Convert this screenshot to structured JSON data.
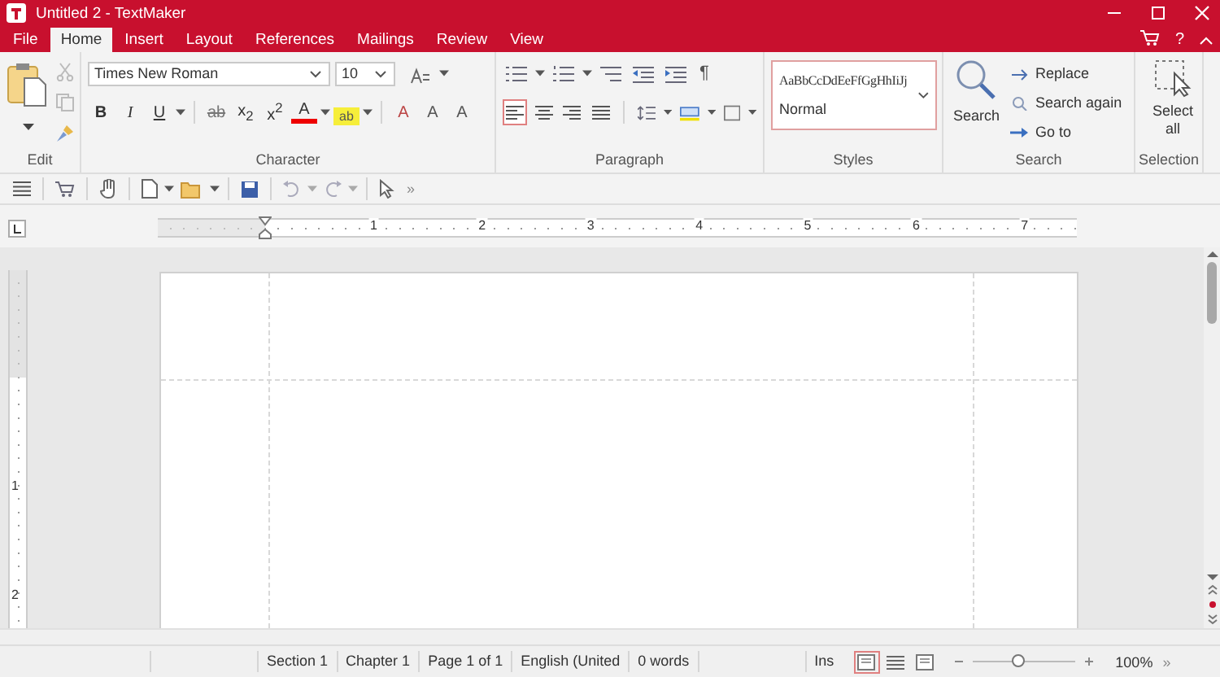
{
  "window": {
    "title": "Untitled 2 - TextMaker"
  },
  "tabs": [
    {
      "label": "File",
      "selected": false
    },
    {
      "label": "Home",
      "selected": true
    },
    {
      "label": "Insert",
      "selected": false
    },
    {
      "label": "Layout",
      "selected": false
    },
    {
      "label": "References",
      "selected": false
    },
    {
      "label": "Mailings",
      "selected": false
    },
    {
      "label": "Review",
      "selected": false
    },
    {
      "label": "View",
      "selected": false
    }
  ],
  "help": "?",
  "ribbon": {
    "font_name": "Times New Roman",
    "font_size": "10",
    "character_buttons": [
      {
        "kind": "bold",
        "glyph": "B"
      },
      {
        "kind": "italic",
        "glyph": "I"
      },
      {
        "kind": "underline",
        "glyph": "U"
      },
      {
        "kind": "strike",
        "glyph": "ab"
      },
      {
        "kind": "subscript",
        "glyph": "x$_{2}$"
      },
      {
        "kind": "superscript",
        "glyph": "x$^{2}$"
      },
      {
        "kind": "color",
        "glyph": "A"
      },
      {
        "kind": "highlight",
        "glyph": "ab"
      },
      {
        "kind": "clear",
        "glyph": "A"
      },
      {
        "kind": "grow",
        "glyph": "A"
      },
      {
        "kind": "shrink",
        "glyph": "A"
      }
    ],
    "paragraph_mark": "¶",
    "alignments": [
      {
        "selected": true
      },
      {
        "selected": false
      },
      {
        "selected": false
      },
      {
        "selected": false
      }
    ],
    "styles": {
      "sample": "AaBbCcDdEeFfGgHhIiJj",
      "current": "Normal"
    },
    "search": {
      "label": "Search",
      "actions": [
        "Replace",
        "Search again",
        "Go to"
      ]
    },
    "select_all": "Select all",
    "groups": [
      "Edit",
      "Character",
      "Paragraph",
      "Styles",
      "Search",
      "Selection"
    ]
  },
  "toolbar": {
    "more": "»"
  },
  "ruler": {
    "marks": [
      "1",
      "2",
      "3",
      "4",
      "5",
      "6",
      "7"
    ]
  },
  "vertical_ruler": {
    "marks": [
      "1",
      "2"
    ]
  },
  "status_bar": {
    "cells": [
      "Section 1",
      "Chapter 1",
      "Page 1 of 1",
      "English (United",
      "0 words"
    ],
    "mode": "Ins",
    "view_modes": [
      {
        "selected": true
      },
      {
        "selected": false
      },
      {
        "selected": false
      }
    ],
    "zoom": {
      "level": 0.45,
      "reading": "100%"
    },
    "more": "»"
  }
}
